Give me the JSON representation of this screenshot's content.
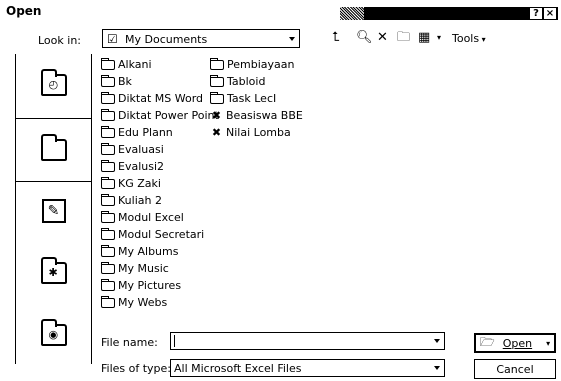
{
  "window": {
    "title": "Open",
    "help_label": "?",
    "close_label": "×"
  },
  "toolbar": {
    "look_in_label": "Look in:",
    "look_in_value": "My Documents",
    "tools_label": "Tools",
    "icons": [
      "up-folder-icon",
      "search-web-icon",
      "delete-icon",
      "new-folder-icon",
      "views-icon"
    ]
  },
  "sidebar": {
    "items": [
      {
        "icon": "history-icon"
      },
      {
        "icon": "my-documents-icon"
      },
      {
        "icon": "desktop-icon"
      },
      {
        "icon": "favorites-icon"
      },
      {
        "icon": "web-folders-icon"
      }
    ]
  },
  "files": {
    "col1": [
      "Alkani",
      "Bk",
      "Diktat MS Word",
      "Diktat Power Point",
      "Edu Plann",
      "Evaluasi",
      "Evalusi2",
      "KG Zaki",
      "Kuliah 2",
      "Modul Excel",
      "Modul Secretari",
      "My Albums",
      "My Music",
      "My Pictures",
      "My Webs"
    ],
    "col2_folders": [
      "Pembiayaan",
      "Tabloid",
      "Task LecI"
    ],
    "col2_files": [
      "Beasiswa BBE",
      "Nilai Lomba"
    ]
  },
  "footer": {
    "file_name_label": "File name:",
    "file_name_value": "",
    "file_type_label": "Files of type:",
    "file_type_value": "All Microsoft Excel Files",
    "open_label": "Open",
    "cancel_label": "Cancel"
  }
}
